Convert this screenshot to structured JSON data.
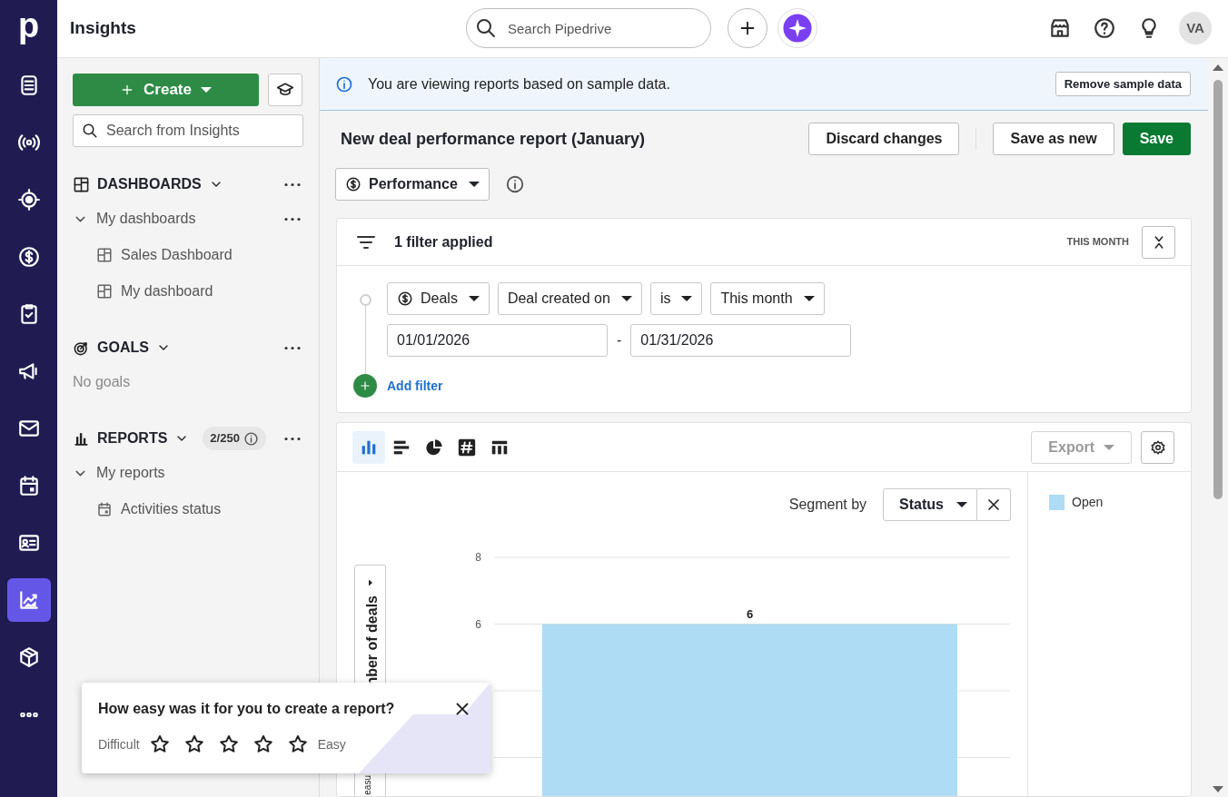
{
  "top_bar": {
    "logo": "p",
    "title": "Insights",
    "search_placeholder": "Search Pipedrive",
    "avatar": "VA"
  },
  "nav_rail": [
    {
      "kind": "notes",
      "selected": false
    },
    {
      "kind": "radar",
      "selected": false
    },
    {
      "kind": "target",
      "selected": false
    },
    {
      "kind": "dollar",
      "selected": false
    },
    {
      "kind": "clipboard",
      "selected": false
    },
    {
      "kind": "megaphone",
      "selected": false
    },
    {
      "kind": "mail",
      "selected": false
    },
    {
      "kind": "calendar",
      "selected": false
    },
    {
      "kind": "card",
      "selected": false
    },
    {
      "kind": "chart",
      "selected": true
    },
    {
      "kind": "box",
      "selected": false
    },
    {
      "kind": "more",
      "selected": false
    }
  ],
  "sidebar": {
    "create_label": "Create",
    "search_placeholder": "Search from Insights",
    "sections": [
      {
        "kind": "dashboards",
        "title": "DASHBOARDS",
        "groups": [
          {
            "title": "My dashboards",
            "expanded": true,
            "children": [
              {
                "kind": "dashboard",
                "label": "Sales Dashboard"
              },
              {
                "kind": "dashboard",
                "label": "My dashboard"
              }
            ]
          }
        ]
      },
      {
        "kind": "goals",
        "title": "GOALS",
        "empty_text": "No goals"
      },
      {
        "kind": "reports",
        "title": "REPORTS",
        "count": "2/250",
        "groups": [
          {
            "title": "My reports",
            "expanded": true,
            "children": [
              {
                "kind": "report",
                "label": "Activities status"
              }
            ]
          }
        ]
      }
    ]
  },
  "banner": {
    "text": "You are viewing reports based on sample data.",
    "button": "Remove sample data"
  },
  "report": {
    "title": "New deal performance report (January)",
    "buttons": [
      {
        "kind": "secondary",
        "label": "Discard changes"
      },
      {
        "kind": "secondary",
        "label": "Save as new"
      },
      {
        "kind": "primary",
        "label": "Save"
      }
    ],
    "type_dropdown": "Performance"
  },
  "filters": {
    "summary": "1 filter applied",
    "period": "THIS MONTH",
    "conditions": [
      {
        "entity": "Deals",
        "field": "Deal created on",
        "operator": "is",
        "value": "This month",
        "from": "01/01/2026",
        "separator": "-",
        "to": "01/31/2026"
      }
    ],
    "add_label": "Add filter"
  },
  "chart_panel": {
    "chart_types": [
      {
        "kind": "column",
        "selected": true
      },
      {
        "kind": "bar",
        "selected": false
      },
      {
        "kind": "pie",
        "selected": false
      },
      {
        "kind": "number",
        "selected": false
      },
      {
        "kind": "table",
        "selected": false
      }
    ],
    "export": "Export",
    "export_disabled": true,
    "segment_label": "Segment by",
    "segment_value": "Status",
    "axis_tab": {
      "text_top": "nber of deals",
      "text_bottom": "easu"
    },
    "chart_data": {
      "type": "bar",
      "series": [
        {
          "name": "Open",
          "color": "#aedcf4",
          "values": [
            6
          ]
        }
      ],
      "ylim": [
        0,
        8
      ],
      "yticks": [
        8,
        6
      ],
      "data_labels": true
    }
  },
  "feedback": {
    "question": "How easy was it for you to create a report?",
    "low_label": "Difficult",
    "high_label": "Easy",
    "stars": 0
  }
}
